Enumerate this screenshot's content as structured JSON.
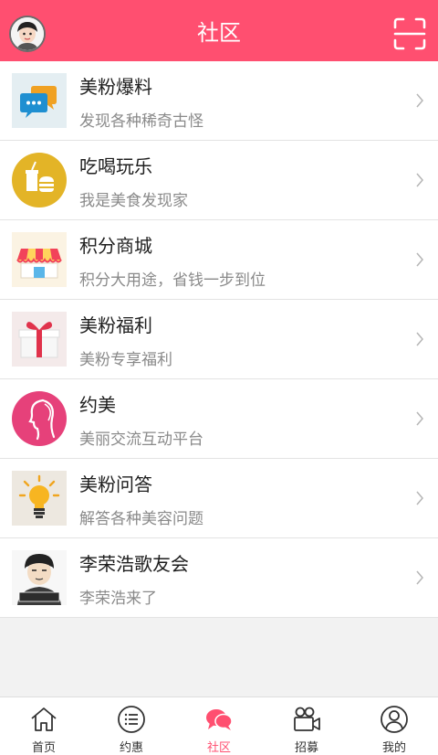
{
  "header": {
    "title": "社区"
  },
  "list": {
    "items": [
      {
        "name": "美粉爆料",
        "desc": "发现各种稀奇古怪",
        "icon": "chat-bubbles-icon"
      },
      {
        "name": "吃喝玩乐",
        "desc": "我是美食发现家",
        "icon": "food-drink-icon"
      },
      {
        "name": "积分商城",
        "desc": "积分大用途，省钱一步到位",
        "icon": "shop-icon"
      },
      {
        "name": "美粉福利",
        "desc": "美粉专享福利",
        "icon": "gift-icon"
      },
      {
        "name": "约美",
        "desc": "美丽交流互动平台",
        "icon": "woman-profile-icon"
      },
      {
        "name": "美粉问答",
        "desc": "解答各种美容问题",
        "icon": "lightbulb-icon"
      },
      {
        "name": "李荣浩歌友会",
        "desc": "李荣浩来了",
        "icon": "fan-club-avatar-icon",
        "avatar_caption": "李荣浩歌友会"
      }
    ]
  },
  "tabbar": {
    "tabs": [
      {
        "label": "首页",
        "icon": "home-icon"
      },
      {
        "label": "约惠",
        "icon": "list-icon"
      },
      {
        "label": "社区",
        "icon": "community-chat-icon",
        "active": true
      },
      {
        "label": "招募",
        "icon": "video-camera-icon"
      },
      {
        "label": "我的",
        "icon": "user-icon"
      }
    ]
  },
  "colors": {
    "accent": "#ff4f70",
    "text": "#1e1e1e",
    "subtext": "#8a8a8a"
  }
}
